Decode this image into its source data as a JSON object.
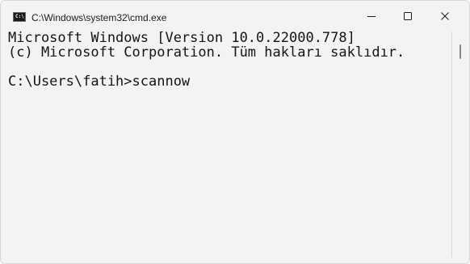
{
  "window": {
    "title": "C:\\Windows\\system32\\cmd.exe",
    "icon": "cmd-icon",
    "icon_glyph": "C:\\",
    "controls": {
      "minimize": "minimize-icon",
      "maximize": "maximize-icon",
      "close": "close-icon"
    }
  },
  "console": {
    "lines": [
      "Microsoft Windows [Version 10.0.22000.778]",
      "(c) Microsoft Corporation. Tüm hakları saklıdır.",
      "",
      "C:\\Users\\fatih>scannow"
    ],
    "background_color": "#f3f3f3",
    "text_color": "#141414"
  }
}
